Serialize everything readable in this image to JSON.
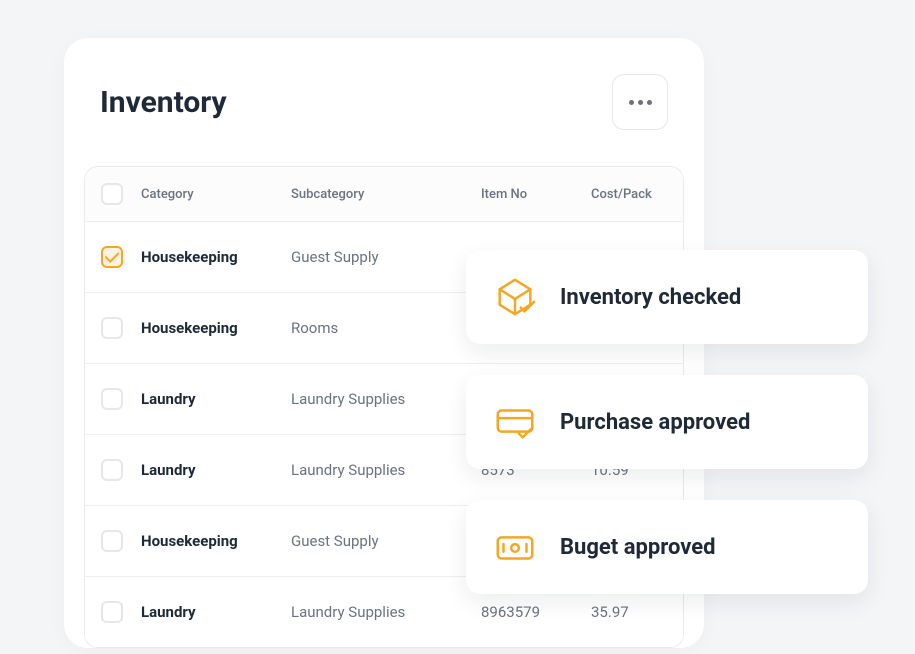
{
  "header": {
    "title": "Inventory"
  },
  "columns": {
    "category": "Category",
    "subcategory": "Subcategory",
    "item_no": "Item No",
    "cost_pack": "Cost/Pack"
  },
  "rows": [
    {
      "checked": true,
      "category": "Housekeeping",
      "subcategory": "Guest Supply",
      "item_no": "",
      "cost": ""
    },
    {
      "checked": false,
      "category": "Housekeeping",
      "subcategory": "Rooms",
      "item_no": "",
      "cost": ""
    },
    {
      "checked": false,
      "category": "Laundry",
      "subcategory": "Laundry Supplies",
      "item_no": "",
      "cost": ""
    },
    {
      "checked": false,
      "category": "Laundry",
      "subcategory": "Laundry Supplies",
      "item_no": "8573",
      "cost": "10.59"
    },
    {
      "checked": false,
      "category": "Housekeeping",
      "subcategory": "Guest Supply",
      "item_no": "",
      "cost": ""
    },
    {
      "checked": false,
      "category": "Laundry",
      "subcategory": "Laundry Supplies",
      "item_no": "8963579",
      "cost": "35.97"
    }
  ],
  "notifications": [
    {
      "label": "Inventory checked"
    },
    {
      "label": "Purchase approved"
    },
    {
      "label": "Buget approved"
    }
  ]
}
